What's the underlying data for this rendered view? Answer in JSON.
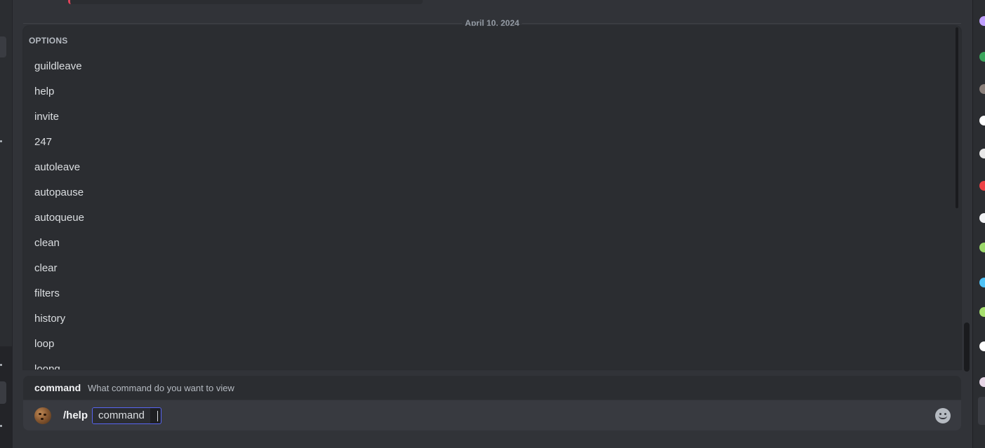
{
  "date_divider": "April 10, 2024",
  "autocomplete": {
    "header": "OPTIONS",
    "items": [
      "guildleave",
      "help",
      "invite",
      "247",
      "autoleave",
      "autopause",
      "autoqueue",
      "clean",
      "clear",
      "filters",
      "history",
      "loop",
      "loopq"
    ]
  },
  "command_hint": {
    "option_name": "command",
    "description": "What command do you want to view"
  },
  "composer": {
    "command": "/help",
    "option_label": "command",
    "bot_avatar": "cookie-avatar",
    "emoji_icon": "smile-emoji-icon"
  },
  "member_avatar_colors": [
    "#c0a0ff",
    "#3ba55c",
    "#8a7f7a",
    "#ffffff",
    "#e8e8e8",
    "#ed4245",
    "#f2f3f5",
    "#9bd86a",
    "#4fc3f7",
    "#a7e06f",
    "#ffffff",
    "#e6d6e6"
  ],
  "colors": {
    "accent": "#5865f2",
    "reply_bar": "#e0435a"
  }
}
